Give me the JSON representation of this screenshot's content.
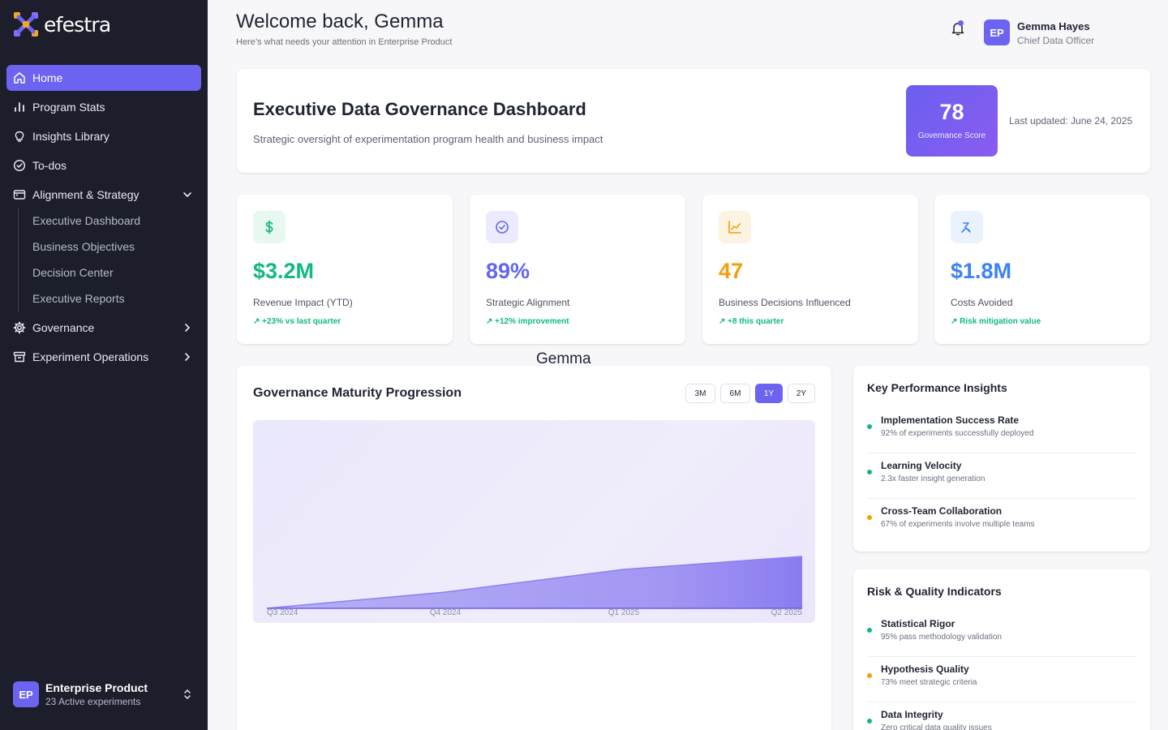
{
  "brand": {
    "name": "efestra"
  },
  "sidebar": {
    "items": [
      {
        "label": "Home",
        "icon": "home-icon",
        "active": true
      },
      {
        "label": "Program Stats",
        "icon": "bar-chart-icon"
      },
      {
        "label": "Insights Library",
        "icon": "lightbulb-icon"
      },
      {
        "label": "To-dos",
        "icon": "check-circle-icon"
      },
      {
        "label": "Alignment & Strategy",
        "icon": "calendar-icon",
        "expanded": true
      },
      {
        "label": "Governance",
        "icon": "gear-icon"
      },
      {
        "label": "Experiment Operations",
        "icon": "archive-icon"
      }
    ],
    "subitems": [
      "Executive Dashboard",
      "Business Objectives",
      "Decision Center",
      "Executive Reports"
    ],
    "workspace": {
      "initials": "EP",
      "name": "Enterprise Product",
      "sub": "23 Active experiments"
    }
  },
  "header": {
    "welcome": "Welcome back, Gemma",
    "subtitle": "Here’s what needs your attention in Enterprise Product",
    "user": {
      "initials": "EP",
      "name": "Gemma Hayes",
      "role": "Chief Data Officer"
    }
  },
  "hero": {
    "title": "Executive Data Governance Dashboard",
    "subtitle": "Strategic oversight of experimentation program health and business impact",
    "score": "78",
    "score_label": "Governance Score",
    "updated": "Last updated: June 24, 2025"
  },
  "kpis": [
    {
      "value": "$3.2M",
      "label": "Revenue Impact (YTD)",
      "trend": "↗ +23% vs last quarter",
      "color": "#10b981",
      "bg": "#e7f8f1",
      "icon": "dollar-icon"
    },
    {
      "value": "89%",
      "label": "Strategic Alignment",
      "trend": "↗ +12% improvement",
      "color": "#6366f1",
      "bg": "#ecebfd",
      "icon": "target-icon"
    },
    {
      "value": "47",
      "label": "Business Decisions Influenced",
      "trend": "↗ +8 this quarter",
      "color": "#f59e0b",
      "bg": "#fdf3e3",
      "icon": "line-chart-icon"
    },
    {
      "value": "$1.8M",
      "label": "Costs Avoided",
      "trend": "↗ Risk mitigation value",
      "color": "#3b82f6",
      "bg": "#eaf2fd",
      "icon": "shield-icon"
    }
  ],
  "floating_text": "Gemma",
  "chart": {
    "title": "Governance Maturity Progression",
    "ranges": [
      "3M",
      "6M",
      "1Y",
      "2Y"
    ],
    "active_range": "1Y"
  },
  "chart_data": {
    "type": "area",
    "title": "Governance Maturity Progression",
    "categories": [
      "Q3 2024",
      "Q4 2024",
      "Q1 2025",
      "Q2 2025"
    ],
    "values": [
      0,
      10,
      24,
      32
    ],
    "xlabel": "",
    "ylabel": "",
    "grid": false,
    "legend": "none"
  },
  "insights": {
    "title": "Key Performance Insights",
    "items": [
      {
        "title": "Implementation Success Rate",
        "desc": "92% of experiments successfully deployed",
        "color": "#10b981"
      },
      {
        "title": "Learning Velocity",
        "desc": "2.3x faster insight generation",
        "color": "#10b981"
      },
      {
        "title": "Cross-Team Collaboration",
        "desc": "67% of experiments involve multiple teams",
        "color": "#f59e0b"
      }
    ]
  },
  "risk": {
    "title": "Risk & Quality Indicators",
    "items": [
      {
        "title": "Statistical Rigor",
        "desc": "95% pass methodology validation",
        "color": "#10b981"
      },
      {
        "title": "Hypothesis Quality",
        "desc": "73% meet strategic criteria",
        "color": "#f59e0b"
      },
      {
        "title": "Data Integrity",
        "desc": "Zero critical data quality issues",
        "color": "#10b981"
      }
    ]
  }
}
